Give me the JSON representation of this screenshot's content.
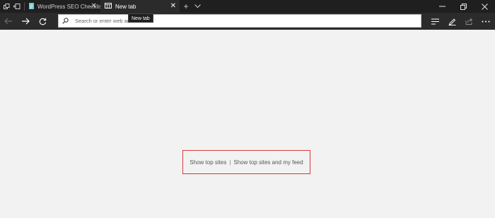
{
  "tabs": [
    {
      "label": "WordPress SEO Checklist - -",
      "icon": "document-icon",
      "active": false
    },
    {
      "label": "New tab",
      "icon": "newtab-grid-icon",
      "active": true
    }
  ],
  "tooltip": "New tab",
  "address_bar": {
    "placeholder": "Search or enter web address",
    "value": ""
  },
  "content": {
    "show_top_sites": "Show top sites",
    "separator": "|",
    "show_top_sites_and_feed": "Show top sites and my feed"
  },
  "colors": {
    "accent_border": "#d43a3a",
    "tab_bar": "#1f1f1f",
    "nav_bar": "#2b2b2b",
    "page_bg": "#f2f2f2"
  }
}
